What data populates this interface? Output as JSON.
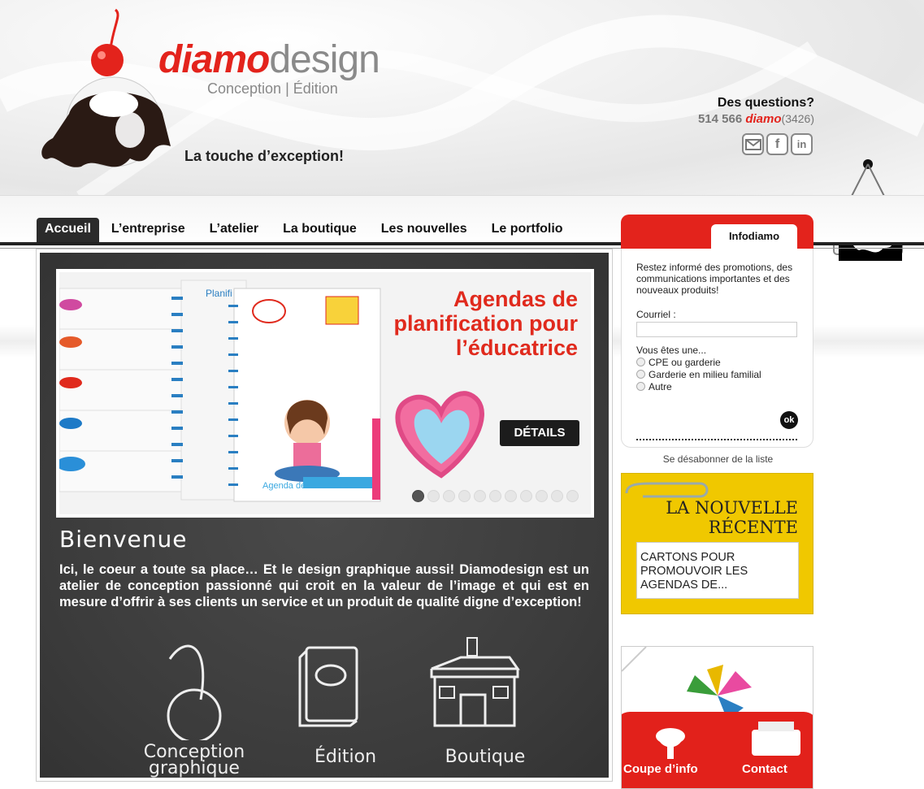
{
  "brand": {
    "name_red": "diamo",
    "name_grey": "design",
    "subtitle": "Conception | Édition",
    "tagline": "La touche d’exception!"
  },
  "contact": {
    "question": "Des questions?",
    "phone_prefix": "514 566",
    "phone_word": "diamo",
    "phone_digits": "(3426)"
  },
  "social": [
    "email-icon",
    "facebook-icon",
    "linkedin-icon"
  ],
  "nav": [
    {
      "label": "Accueil",
      "active": true
    },
    {
      "label": "L’entreprise"
    },
    {
      "label": "L’atelier"
    },
    {
      "label": "La boutique"
    },
    {
      "label": "Les nouvelles"
    },
    {
      "label": "Le portfolio"
    }
  ],
  "slider": {
    "title_line1": "Agendas de",
    "title_line2": "planification pour",
    "title_line3": "l’éducatrice",
    "cta": "DÉTAILS",
    "agenda_cover_text": "Agenda de l’éducatrice",
    "planif_text": "Planifi",
    "slide_count": 11,
    "active_slide": 1
  },
  "welcome": {
    "title": "Bienvenue",
    "text": "Ici, le coeur a toute sa place… Et le design graphique aussi! Diamodesign est un atelier de conception passionné qui croit en la valeur de l’image et qui est en mesure d’offrir à ses clients un service et un produit de qualité digne d’exception!"
  },
  "tiles": {
    "conception_1": "Conception",
    "conception_2": "graphique",
    "edition": "Édition",
    "boutique": "Boutique"
  },
  "newsletter": {
    "tab": "Infodiamo",
    "intro": "Restez informé des promotions, des communications importantes et des nouveaux produits!",
    "email_label": "Courriel :",
    "type_label": "Vous êtes une...",
    "options": [
      "CPE ou garderie",
      "Garderie en milieu familial",
      "Autre"
    ],
    "ok": "ok",
    "unsubscribe": "Se désabonner de la liste"
  },
  "news": {
    "title_1": "LA NOUVELLE",
    "title_2": "RÉCENTE",
    "headline": "CARTONS POUR PROMOUVOIR LES AGENDAS DE..."
  },
  "promo": {
    "left": "Coupe d’info",
    "right": "Contact"
  },
  "colors": {
    "brand_red": "#e3231c",
    "news_yellow": "#f0c800",
    "board": "#3b3b3b"
  }
}
